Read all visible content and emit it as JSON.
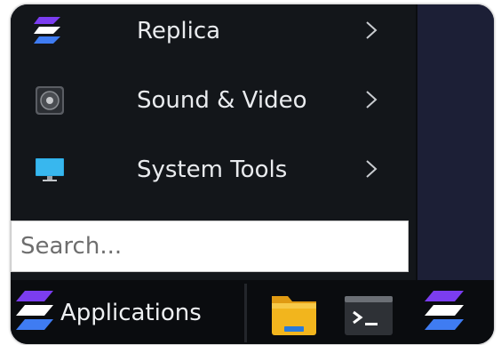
{
  "menu": {
    "items": [
      {
        "label": "Replica",
        "icon": "replica-stack-icon"
      },
      {
        "label": "Sound & Video",
        "icon": "speaker-icon"
      },
      {
        "label": "System Tools",
        "icon": "monitor-icon"
      }
    ]
  },
  "search": {
    "placeholder": "Search..."
  },
  "taskbar": {
    "applications_label": "Applications",
    "launchers": [
      "file-manager-icon",
      "terminal-icon",
      "replica-stack-icon"
    ]
  },
  "colors": {
    "menu_bg": "#13161a",
    "desktop_bg": "#1c1f36",
    "taskbar_bg": "#0a0c0f",
    "stack_blue": "#3f7cf2",
    "stack_purple": "#7b3df0",
    "folder_yellow": "#f2b51d"
  }
}
